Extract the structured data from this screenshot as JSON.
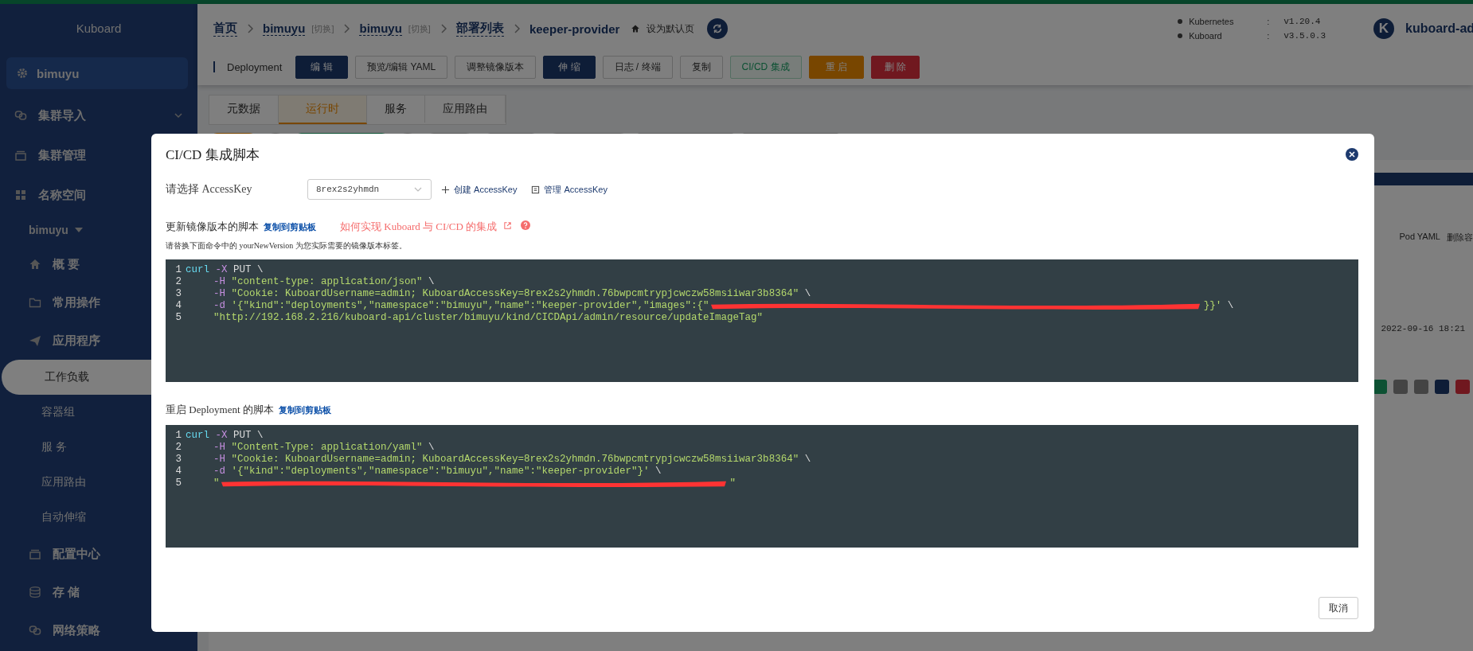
{
  "sidebar": {
    "title": "Kuboard",
    "cluster": "bimuyu",
    "items": [
      {
        "kind": "group",
        "label": "集群导入",
        "expanded": false
      },
      {
        "kind": "group",
        "label": "集群管理"
      },
      {
        "kind": "group",
        "label": "名称空间"
      },
      {
        "kind": "namespace",
        "label": "bimuyu"
      },
      {
        "kind": "item",
        "label": "概 要"
      },
      {
        "kind": "item",
        "label": "常用操作"
      },
      {
        "kind": "item",
        "label": "应用程序"
      },
      {
        "kind": "sub",
        "label": "工作负载",
        "selected": true
      },
      {
        "kind": "sub",
        "label": "容器组",
        "selected": false
      },
      {
        "kind": "sub",
        "label": "服 务",
        "selected": false
      },
      {
        "kind": "sub",
        "label": "应用路由",
        "selected": false
      },
      {
        "kind": "sub",
        "label": "自动伸缩",
        "selected": false
      },
      {
        "kind": "item",
        "label": "配置中心"
      },
      {
        "kind": "item",
        "label": "存 储"
      },
      {
        "kind": "item",
        "label": "网络策略"
      }
    ]
  },
  "breadcrumb": [
    {
      "kind": "link",
      "text": "首页"
    },
    {
      "kind": "link",
      "text": "bimuyu"
    },
    {
      "kind": "switch",
      "text": "[切换]"
    },
    {
      "kind": "link",
      "text": "bimuyu"
    },
    {
      "kind": "switch",
      "text": "[切换]"
    },
    {
      "kind": "link",
      "text": "部署列表"
    },
    {
      "kind": "current",
      "text": "keeper-provider"
    }
  ],
  "set_default": "设为默认页",
  "versions": [
    {
      "name": "Kubernetes",
      "separator": ":",
      "value": "v1.20.4"
    },
    {
      "name": "Kuboard",
      "separator": ":",
      "value": "v3.5.0.3"
    }
  ],
  "user": {
    "initial": "K",
    "name": "kuboard-ad"
  },
  "toolbar": {
    "label": "Deployment",
    "buttons": [
      {
        "kind": "primary",
        "text": "编 辑"
      },
      {
        "kind": "default",
        "text": "预览/编辑 YAML"
      },
      {
        "kind": "default",
        "text": "调整镜像版本"
      },
      {
        "kind": "primary",
        "text": "伸 缩"
      },
      {
        "kind": "default",
        "text": "日志 / 终端"
      },
      {
        "kind": "default",
        "text": "复制"
      },
      {
        "kind": "success",
        "text": "CI/CD 集成"
      },
      {
        "kind": "warning",
        "text": "重 启"
      },
      {
        "kind": "danger",
        "text": "删 除"
      }
    ]
  },
  "tabs": [
    {
      "label": "元数据",
      "selected": false
    },
    {
      "label": "运行时",
      "selected": true
    },
    {
      "label": "服务",
      "selected": false
    },
    {
      "label": "应用路由",
      "selected": false
    }
  ],
  "background_right": {
    "pod_yaml": "Pod YAML",
    "delete": "删除容",
    "time": "2022-09-16 18:21"
  },
  "dialog": {
    "title": "CI/CD 集成脚本",
    "access_key_label": "请选择 AccessKey",
    "access_key": "8rex2s2yhmdn",
    "create_link": "创建 AccessKey",
    "manage_link": "管理 AccessKey",
    "sections": [
      {
        "title": "更新镜像版本的脚本",
        "copy": "复制到剪贴板",
        "help": "如何实现 Kuboard 与 CI/CD 的集成",
        "note": "请替换下面命令中的 yourNewVersion 为您实际需要的镜像版本标签。",
        "lines": [
          {
            "number": "1",
            "tokens": [
              {
                "kind": "command",
                "text": "curl"
              },
              {
                "kind": "flag",
                "text": "-X"
              },
              {
                "kind": "plain",
                "text": "PUT \\"
              }
            ]
          },
          {
            "number": "2",
            "tokens": [
              {
                "kind": "flag",
                "text": "-H"
              },
              {
                "kind": "string",
                "text": "\"content-type: application/json\""
              },
              {
                "kind": "plain",
                "text": "\\"
              }
            ]
          },
          {
            "number": "3",
            "tokens": [
              {
                "kind": "flag",
                "text": "-H"
              },
              {
                "kind": "string",
                "text": "\"Cookie: KuboardUsername=admin; KuboardAccessKey=8rex2s2yhmdn.76bwpcmtrypjcwczw58msiiwar3b8364\""
              },
              {
                "kind": "plain",
                "text": "\\"
              }
            ]
          },
          {
            "number": "4",
            "tokens": [
              {
                "kind": "flag",
                "text": "-d"
              },
              {
                "kind": "string",
                "text": "'{\"kind\":\"deployments\",\"namespace\":\"bimuyu\",\"name\":\"keeper-provider\",\"images\":{\""
              },
              {
                "kind": "redacted"
              },
              {
                "kind": "string",
                "text": "}}'"
              },
              {
                "kind": "plain",
                "text": "\\"
              }
            ]
          },
          {
            "number": "5",
            "tokens": [
              {
                "kind": "string",
                "text": "\"http://192.168.2.216/kuboard-api/cluster/bimuyu/kind/CICDApi/admin/resource/updateImageTag\""
              }
            ]
          }
        ]
      },
      {
        "title": "重启 Deployment 的脚本",
        "copy": "复制到剪贴板",
        "lines": [
          {
            "number": "1",
            "tokens": [
              {
                "kind": "command",
                "text": "curl"
              },
              {
                "kind": "flag",
                "text": "-X"
              },
              {
                "kind": "plain",
                "text": "PUT \\"
              }
            ]
          },
          {
            "number": "2",
            "tokens": [
              {
                "kind": "flag",
                "text": "-H"
              },
              {
                "kind": "string",
                "text": "\"Content-Type: application/yaml\""
              },
              {
                "kind": "plain",
                "text": "\\"
              }
            ]
          },
          {
            "number": "3",
            "tokens": [
              {
                "kind": "flag",
                "text": "-H"
              },
              {
                "kind": "string",
                "text": "\"Cookie: KuboardUsername=admin; KuboardAccessKey=8rex2s2yhmdn.76bwpcmtrypjcwczw58msiiwar3b8364\""
              },
              {
                "kind": "plain",
                "text": "\\"
              }
            ]
          },
          {
            "number": "4",
            "tokens": [
              {
                "kind": "flag",
                "text": "-d"
              },
              {
                "kind": "string",
                "text": "'{\"kind\":\"deployments\",\"namespace\":\"bimuyu\",\"name\":\"keeper-provider\"}'"
              },
              {
                "kind": "plain",
                "text": "\\"
              }
            ]
          },
          {
            "number": "5",
            "tokens": [
              {
                "kind": "string",
                "text": "\""
              },
              {
                "kind": "redacted"
              },
              {
                "kind": "string",
                "text": "\""
              }
            ]
          }
        ]
      }
    ],
    "cancel": "取消"
  }
}
